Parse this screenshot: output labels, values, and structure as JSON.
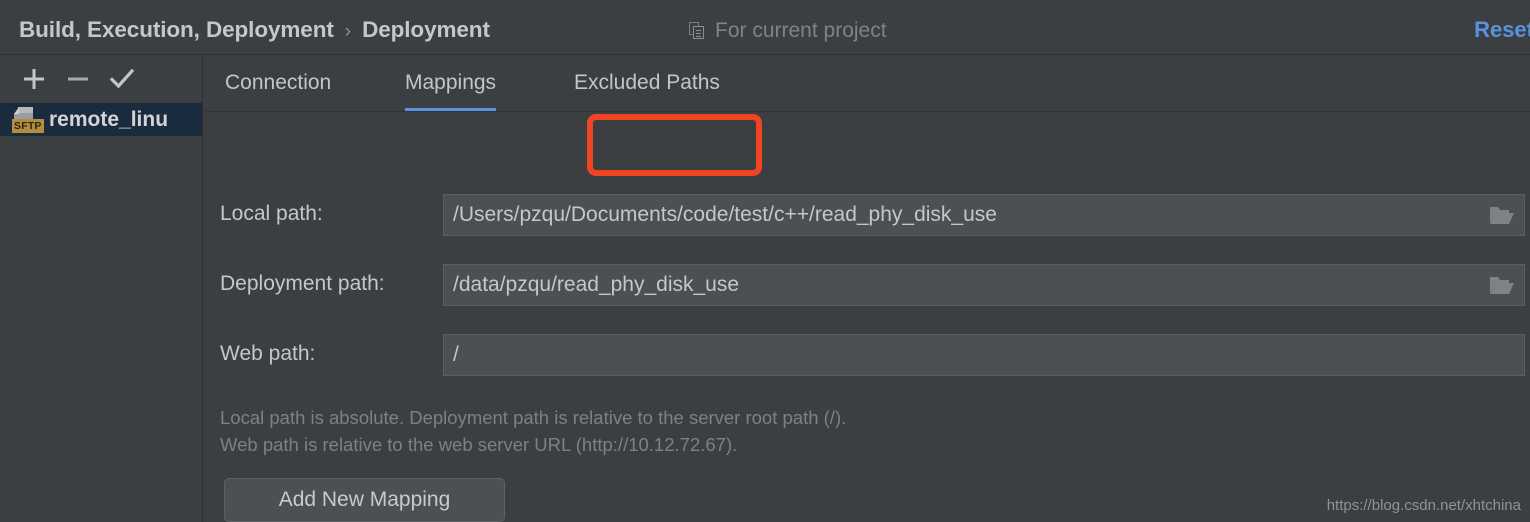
{
  "header": {
    "breadcrumb": [
      "Build, Execution, Deployment",
      "Deployment"
    ],
    "separator": "›",
    "scope_icon": "copy-project-icon",
    "scope_label": "For current project",
    "reset_label": "Reset",
    "reset_color": "#5b91df"
  },
  "sidebar": {
    "toolbar": [
      {
        "name": "add-server-button",
        "icon": "plus-icon",
        "label": "+"
      },
      {
        "name": "remove-server-button",
        "icon": "minus-icon",
        "label": "−"
      },
      {
        "name": "set-default-server-button",
        "icon": "check-icon",
        "label": "✓"
      }
    ],
    "servers": [
      {
        "name": "remote_linu",
        "badge": "SFTP",
        "icon": "sftp-server-icon",
        "selected": true
      }
    ]
  },
  "tabs": [
    {
      "id": "connection",
      "label": "Connection",
      "active": false
    },
    {
      "id": "mappings",
      "label": "Mappings",
      "active": true
    },
    {
      "id": "excluded",
      "label": "Excluded Paths",
      "active": false
    }
  ],
  "annotation": {
    "target": "mappings-tab",
    "color": "#f04423",
    "shape": "rounded-rectangle"
  },
  "form": {
    "local_path": {
      "label": "Local path:",
      "value": "/Users/pzqu/Documents/code/test/c++/read_phy_disk_use",
      "browse_icon": "folder-open-icon"
    },
    "deployment_path": {
      "label": "Deployment path:",
      "value": "/data/pzqu/read_phy_disk_use",
      "browse_icon": "folder-open-icon"
    },
    "web_path": {
      "label": "Web path:",
      "value": "/"
    },
    "help_line_1": "Local path is absolute. Deployment path is relative to the server root path (/).",
    "help_line_2": "Web path is relative to the web server URL (http://10.12.72.67).",
    "add_mapping_label": "Add New Mapping"
  },
  "watermark": "https://blog.csdn.net/xhtchina",
  "colors": {
    "window_background": "#3c3f41",
    "field_background": "#4b5052",
    "selection_background": "#1b2b3e",
    "accent_blue": "#5b91df",
    "annotation_red": "#f04423",
    "sftp_badge": "#b08d3f"
  }
}
